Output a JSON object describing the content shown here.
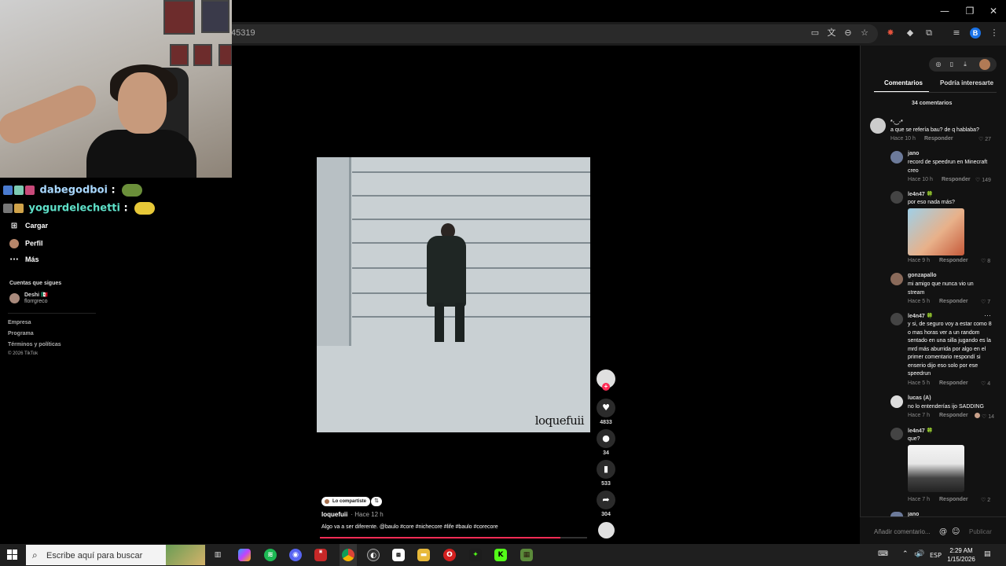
{
  "browser": {
    "url_fragment": "45319"
  },
  "chat": [
    {
      "user": "dabegodboi",
      "sep": ":",
      "color": "#a9d8ff"
    },
    {
      "user": "yogurdelechetti",
      "sep": ":",
      "color": "#5ee0c8"
    }
  ],
  "nav": {
    "items": [
      {
        "icon": "⊞",
        "label": "Cargar"
      },
      {
        "icon": "",
        "label": "Perfil"
      },
      {
        "icon": "···",
        "label": "Más"
      }
    ],
    "following_header": "Cuentas que sigues",
    "following": [
      {
        "name": "Deshi 🇲🇽",
        "handle": "florrgreco"
      }
    ],
    "footer_links": [
      "Empresa",
      "Programa",
      "Términos y políticas"
    ],
    "copyright": "© 2026 TikTok"
  },
  "video": {
    "watermark": "loquefuii",
    "progress": 0.9
  },
  "actions": {
    "likes": "4833",
    "comments": "34",
    "saves": "533",
    "shares": "304"
  },
  "caption": {
    "shared_label": "Lo compartiste",
    "author": "loquefuii",
    "time": "· Hace 12 h",
    "text": "Algo va a ser diferente. @baulo #core #nichecore #life #baulo #corecore"
  },
  "panel": {
    "tabs": [
      "Comentarios",
      "Podría interesarte"
    ],
    "count_label": "34 comentarios",
    "comments": [
      {
        "name": "*-‿-*",
        "text": "a que se refería bau? de q hablaba?",
        "time": "Hace 10 h",
        "reply": "Responder",
        "likes": "27"
      },
      {
        "name": "jano",
        "text": "record de speedrun en Minecraft creo",
        "time": "Hace 10 h",
        "reply": "Responder",
        "likes": "149"
      },
      {
        "name": "le4n47 🍀",
        "text": "por eso nada más?",
        "time": "Hace 9 h",
        "reply": "Responder",
        "likes": "8"
      },
      {
        "name": "gonzapallo",
        "text": "mi amigo que nunca vio un stream",
        "time": "Hace 5 h",
        "reply": "Responder",
        "likes": "7"
      },
      {
        "name": "le4n47 🍀",
        "text": "y si, de seguro voy a estar como 8 o mas horas ver a un random sentado en una silla jugando es la mrd más aburrida por algo en el primer comentario respondí si enserio dijo eso solo por ese speedrun",
        "time": "Hace 5 h",
        "reply": "Responder",
        "likes": "4",
        "more": "···"
      },
      {
        "name": "lucas (A)",
        "text": "no lo entenderías ijo SADDING",
        "time": "Hace 7 h",
        "reply": "Responder",
        "likes": "14"
      },
      {
        "name": "le4n47 🍀",
        "text": "que?",
        "time": "Hace 7 h",
        "reply": "Responder",
        "likes": "2"
      },
      {
        "name": "jano",
        "text": "",
        "time": "",
        "reply": "",
        "likes": ""
      }
    ],
    "input_placeholder": "Añadir comentario...",
    "publish_label": "Publicar"
  },
  "taskbar": {
    "search_placeholder": "Escribe aquí para buscar",
    "lang": "ESP",
    "time": "2:29 AM",
    "date": "1/15/2026"
  }
}
